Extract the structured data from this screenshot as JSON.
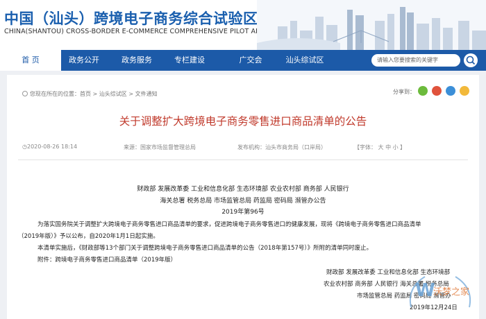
{
  "header": {
    "title": "中国（汕头）跨境电子商务综合试验区",
    "subtitle": "CHINA(SHANTOU) CROSS-BORDER E-COMMERCE COMPREHENSIVE PILOT AREA"
  },
  "nav": {
    "items": [
      {
        "label": "首 页"
      },
      {
        "label": "政务公开"
      },
      {
        "label": "政务服务"
      },
      {
        "label": "专栏建设"
      },
      {
        "label": "广交会"
      },
      {
        "label": "汕头综试区"
      }
    ],
    "search_placeholder": "请输入您要搜索的关键字"
  },
  "breadcrumb": {
    "text": "您现在所在的位置：首页 > 汕头综试区 > 文件通知"
  },
  "share": {
    "label": "分享到：",
    "icons": [
      "wechat-icon",
      "weibo-icon",
      "qq-icon",
      "qzone-icon"
    ],
    "colors": [
      "#6cbb3c",
      "#e0533c",
      "#3c8fd8",
      "#f2b93b"
    ]
  },
  "article": {
    "title": "关于调整扩大跨境电子商务零售进口商品清单的公告",
    "date": "2020-08-26 18:14",
    "source": "来源：国家市场监督管理总局",
    "publisher": "发布机构：汕头市商务局（口岸局）",
    "font_size": "【字体： 大 中 小 】",
    "issuers_line1": "财政部 发展改革委 工业和信息化部 生态环境部 农业农村部 商务部 人民银行",
    "issuers_line2": "海关总署 税务总局 市场监管总局 药监局 密码局 濒管办公告",
    "doc_number": "2019年第96号",
    "para1_line1": "为落实国务院关于调整扩大跨境电子商务零售进口商品清单的要求，促进跨境电子商务零售进口的健康发展，现将《跨境电子商务零售进口商品清单",
    "para1_line2": "（2019年版）》予以公布，自2020年1月1日起实施。",
    "para2": "本清单实施后，《财政部等13个部门关于调整跨境电子商务零售进口商品清单的公告（2018年第157号）》所附的清单同时废止。",
    "attachment": "附件：跨境电子商务零售进口商品清单（2019年版）",
    "sign_line1": "财政部 发展改革委 工业和信息化部 生态环境部",
    "sign_line2": "农业农村部 商务部 人民银行 海关总署 税务总局",
    "sign_line3": "市场监管总局 药监局 密码局 濒管办",
    "sign_date": "2019年12月24日"
  },
  "watermark": {
    "text": "沃梦之家",
    "color": "#7aaedc"
  },
  "colors": {
    "brand_blue": "#1c5aa8",
    "title_red": "#c0392b"
  }
}
